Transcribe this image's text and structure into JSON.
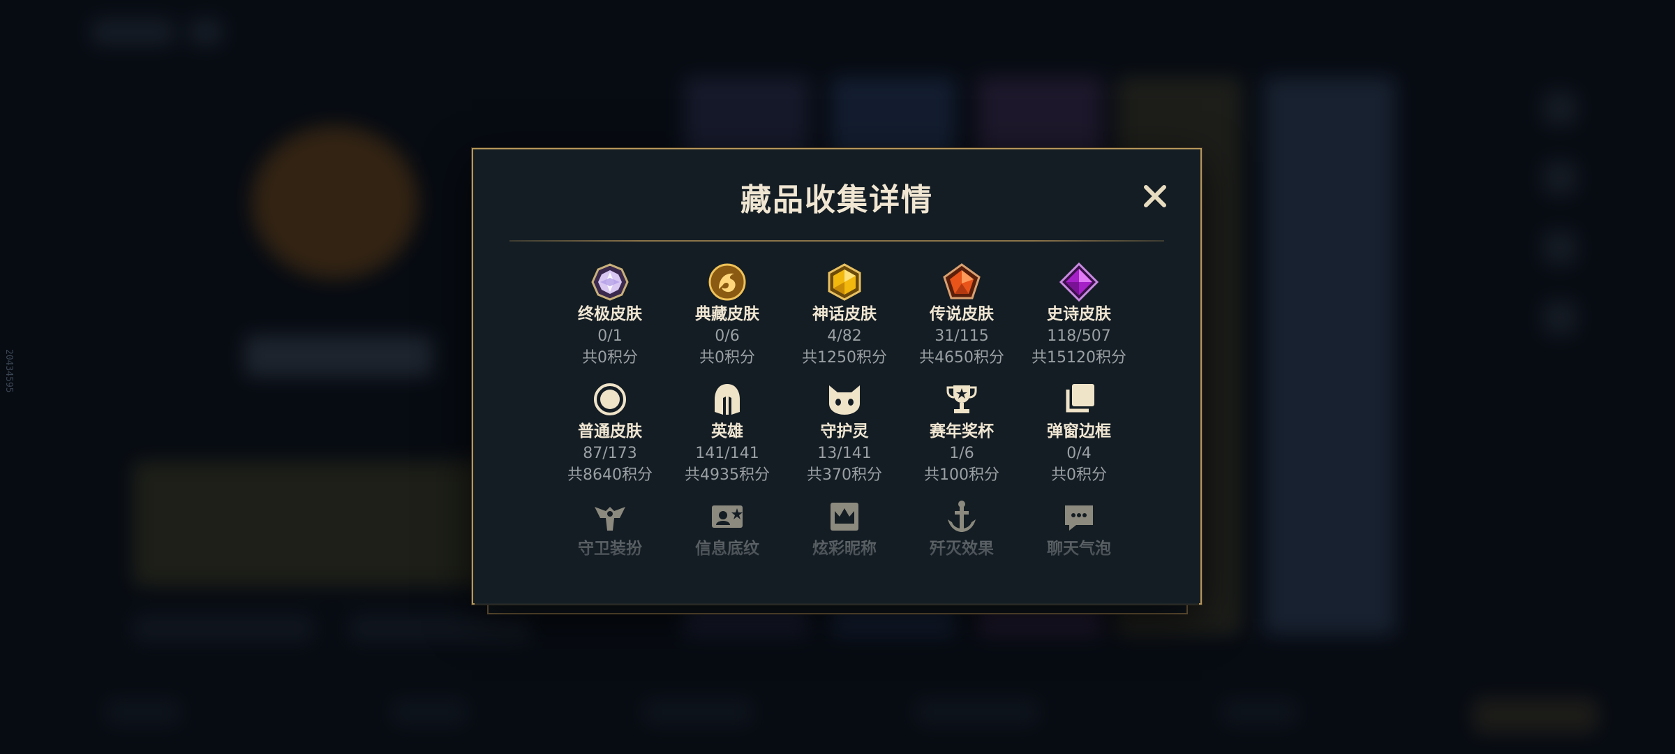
{
  "side_id": "20434595",
  "modal": {
    "title": "藏品收集详情",
    "items": [
      {
        "name": "终极皮肤",
        "count": "0/1",
        "points": "共0积分",
        "icon": "ultimate-gem-icon"
      },
      {
        "name": "典藏皮肤",
        "count": "0/6",
        "points": "共0积分",
        "icon": "dragon-emblem-icon"
      },
      {
        "name": "神话皮肤",
        "count": "4/82",
        "points": "共1250积分",
        "icon": "mythic-gem-icon"
      },
      {
        "name": "传说皮肤",
        "count": "31/115",
        "points": "共4650积分",
        "icon": "legendary-gem-icon"
      },
      {
        "name": "史诗皮肤",
        "count": "118/507",
        "points": "共15120积分",
        "icon": "epic-gem-icon"
      },
      {
        "name": "普通皮肤",
        "count": "87/173",
        "points": "共8640积分",
        "icon": "circle-icon"
      },
      {
        "name": "英雄",
        "count": "141/141",
        "points": "共4935积分",
        "icon": "helmet-icon"
      },
      {
        "name": "守护灵",
        "count": "13/141",
        "points": "共370积分",
        "icon": "guardian-face-icon"
      },
      {
        "name": "赛年奖杯",
        "count": "1/6",
        "points": "共100积分",
        "icon": "trophy-icon"
      },
      {
        "name": "弹窗边框",
        "count": "0/4",
        "points": "共0积分",
        "icon": "frames-icon"
      },
      {
        "name": "守卫装扮",
        "icon": "ward-icon"
      },
      {
        "name": "信息底纹",
        "icon": "info-card-icon"
      },
      {
        "name": "炫彩昵称",
        "icon": "crown-card-icon"
      },
      {
        "name": "歼灭效果",
        "icon": "anchor-icon"
      },
      {
        "name": "聊天气泡",
        "icon": "chat-bubble-icon"
      }
    ]
  },
  "colors": {
    "gold": "#b6975a",
    "title_text": "#f0e6d2",
    "sub_text": "#9aa0a3",
    "panel": "#141d24"
  }
}
